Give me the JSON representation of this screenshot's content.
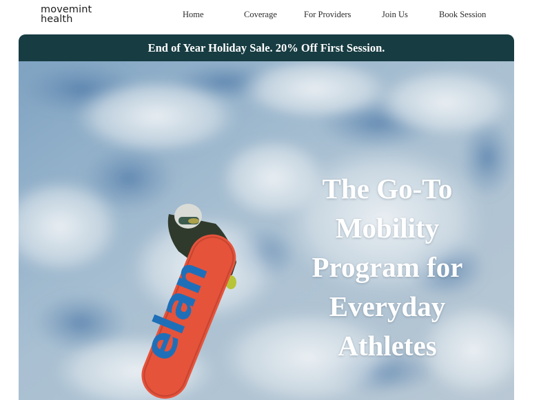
{
  "brand": {
    "logo_line1": "movemint",
    "logo_line2": "health"
  },
  "nav": {
    "items": [
      {
        "label": "Home"
      },
      {
        "label": "Coverage"
      },
      {
        "label": "For Providers"
      },
      {
        "label": "Join Us"
      },
      {
        "label": "Book Session"
      }
    ]
  },
  "banner": {
    "text": "End of Year Holiday Sale. 20% Off First Session.",
    "background": "#173c42"
  },
  "hero": {
    "headline_lines": [
      "The Go-To",
      "Mobility",
      "Program for",
      "Everyday",
      "Athletes"
    ],
    "snowboard_brand": "elan",
    "snowboard_color": "#e5533b",
    "snowboard_text_color": "#1f6fb8"
  }
}
